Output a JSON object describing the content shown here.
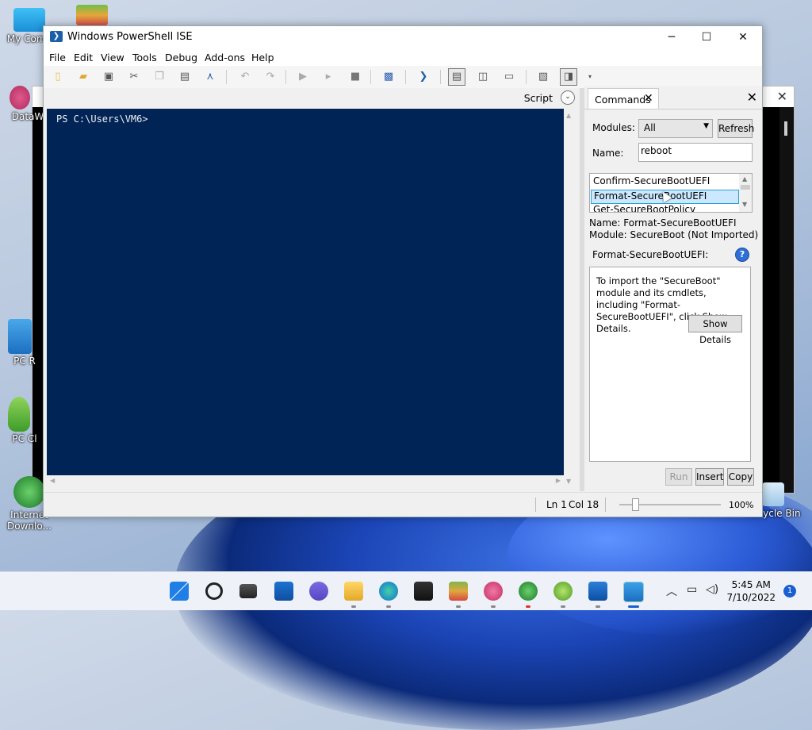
{
  "desktop": {
    "icons": [
      {
        "label": "My Comp"
      },
      {
        "label": "DataW"
      },
      {
        "label": "PC R"
      },
      {
        "label": "PC Cl"
      },
      {
        "label": "Internet Downlo..."
      },
      {
        "label": "Recycle Bin"
      }
    ]
  },
  "window": {
    "title": "Windows PowerShell ISE",
    "minimize": "─",
    "maximize": "☐",
    "close": "✕"
  },
  "menu": [
    "File",
    "Edit",
    "View",
    "Tools",
    "Debug",
    "Add-ons",
    "Help"
  ],
  "script_bar": {
    "label": "Script"
  },
  "console": {
    "prompt": "PS C:\\Users\\VM6>"
  },
  "commands": {
    "tab_label": "Commands",
    "modules_label": "Modules:",
    "modules_value": "All",
    "refresh_label": "Refresh",
    "name_label": "Name:",
    "name_value": "reboot",
    "list_items": [
      "Confirm-SecureBootUEFI",
      "Format-SecureBootUEFI",
      "Get-SecureBootPolicy"
    ],
    "selected_index": 1,
    "info_name": "Name: Format-SecureBootUEFI",
    "info_module": "Module: SecureBoot (Not Imported)",
    "detail_heading": "Format-SecureBootUEFI:",
    "detail_text": "To import the \"SecureBoot\" module and its cmdlets, including \"Format-SecureBootUEFI\", click Show Details.",
    "show_details_label": "Show Details",
    "run_label": "Run",
    "insert_label": "Insert",
    "copy_label": "Copy"
  },
  "status": {
    "ln": "Ln 1",
    "col": "Col 18",
    "zoom": "100%"
  },
  "taskbar": {
    "time": "5:45 AM",
    "date": "7/10/2022",
    "notifications": "1"
  },
  "colors": {
    "console_bg": "#012456",
    "accent": "#1a5fd1"
  }
}
